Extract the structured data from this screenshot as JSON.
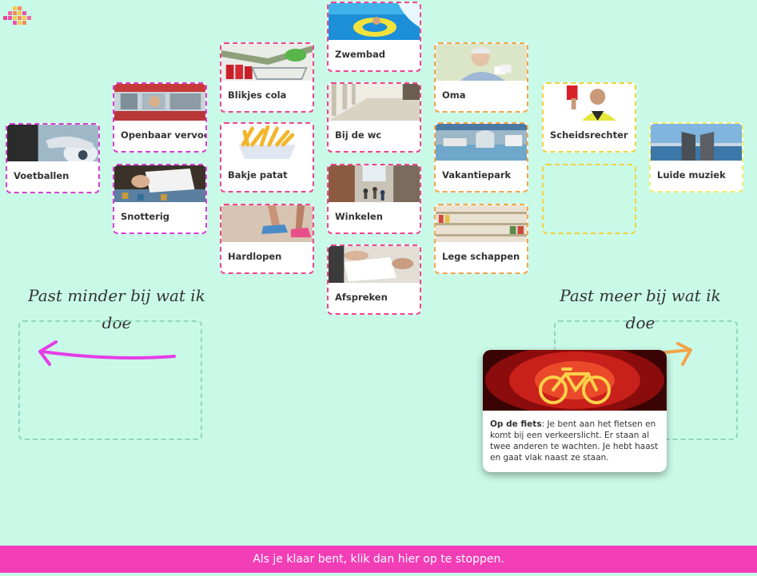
{
  "cards": [
    {
      "label": "Voetballen",
      "photo": "photo-voetballen",
      "color": "#d63ed0"
    },
    {
      "label": "Openbaar vervoer",
      "photo": "photo-openbaar-vervoer",
      "color": "#d63ed0"
    },
    {
      "label": "Snotterig",
      "photo": "photo-snotterig",
      "color": "#d63ed0"
    },
    {
      "label": "Blikjes cola",
      "photo": "photo-blikjes-cola",
      "color": "#e9468f"
    },
    {
      "label": "Bakje patat",
      "photo": "photo-bakje-patat",
      "color": "#e9468f"
    },
    {
      "label": "Hardlopen",
      "photo": "photo-hardlopen",
      "color": "#e9468f"
    },
    {
      "label": "Zwembad",
      "photo": "photo-zwembad",
      "color": "#e9468f"
    },
    {
      "label": "Bij de wc",
      "photo": "photo-bij-de-wc",
      "color": "#e9468f"
    },
    {
      "label": "Winkelen",
      "photo": "photo-winkelen",
      "color": "#e9468f"
    },
    {
      "label": "Afspreken",
      "photo": "photo-afspreken",
      "color": "#e9468f"
    },
    {
      "label": "Oma",
      "photo": "photo-oma",
      "color": "#f2a44b"
    },
    {
      "label": "Vakantiepark",
      "photo": "photo-vakantiepark",
      "color": "#f2a44b"
    },
    {
      "label": "Lege schappen",
      "photo": "photo-lege-schappen",
      "color": "#f2a44b"
    },
    {
      "label": "Scheidsrechter",
      "photo": "photo-scheidsrechter",
      "color": "#f2d13b"
    },
    {
      "label": "Luide muziek",
      "photo": "photo-luide-muziek",
      "color": "#f0ec6a"
    }
  ],
  "left_zone": {
    "label": "Past minder bij wat ik doe",
    "arrow_color": "#e53ee6"
  },
  "right_zone": {
    "label": "Past meer bij wat ik doe",
    "arrow_color": "#f2a44b"
  },
  "popup": {
    "title": "Op de fiets",
    "text": ": Je bent aan het fietsen en komt bij een verkeerslicht. Er staan al twee anderen te wachten. Je hebt haast en gaat vlak naast ze staan.",
    "photo": "photo-op-de-fiets"
  },
  "footer": {
    "label": "Als je klaar bent, klik dan hier op te stoppen.",
    "color": "#f23eb6"
  },
  "background": "#c9fae8"
}
